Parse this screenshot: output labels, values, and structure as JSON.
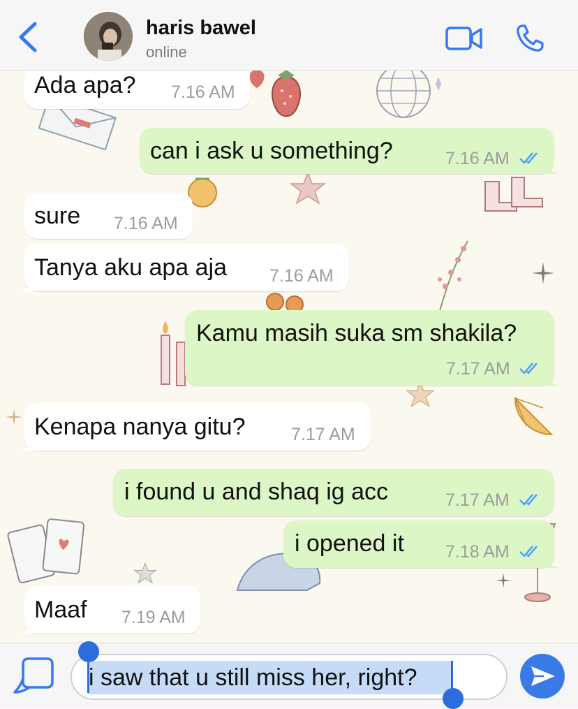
{
  "header": {
    "back_icon": "chevron-left-icon",
    "contact_name": "haris bawel",
    "status": "online",
    "video_icon": "video-camera-icon",
    "call_icon": "phone-icon"
  },
  "messages": [
    {
      "dir": "in",
      "text": "Ada apa?",
      "time": "7.16 AM"
    },
    {
      "dir": "out",
      "text": "can i ask u something?",
      "time": "7.16 AM",
      "read": true
    },
    {
      "dir": "in",
      "text": "sure",
      "time": "7.16 AM"
    },
    {
      "dir": "in",
      "text": "Tanya aku apa aja",
      "time": "7.16 AM"
    },
    {
      "dir": "out",
      "text": "Kamu masih suka sm shakila?",
      "time": "7.17 AM",
      "read": true
    },
    {
      "dir": "in",
      "text": "Kenapa nanya gitu?",
      "time": "7.17 AM"
    },
    {
      "dir": "out",
      "text": "i found u and shaq ig acc",
      "time": "7.17 AM",
      "read": true
    },
    {
      "dir": "out",
      "text": "i opened it",
      "time": "7.18 AM",
      "read": true
    },
    {
      "dir": "in",
      "text": "Maaf",
      "time": "7.19 AM"
    }
  ],
  "composer": {
    "attach_icon": "sticker-icon",
    "text": "i saw that u still miss her, right?",
    "send_icon": "send-arrow-icon"
  },
  "colors": {
    "accent": "#3478f6",
    "outgoing_bubble": "#dcf7c5",
    "incoming_bubble": "#ffffff",
    "wallpaper": "#fbf8ef",
    "read_ticks": "#4fa3f7"
  }
}
